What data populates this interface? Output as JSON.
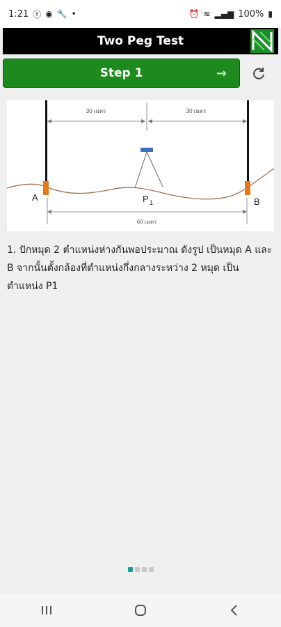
{
  "status": {
    "time": "1:21",
    "battery": "100%"
  },
  "appbar": {
    "title": "Two Peg Test"
  },
  "step": {
    "label": "Step 1"
  },
  "diagram": {
    "label_a": "A",
    "label_b": "B",
    "label_p": "P",
    "label_p_sub": "1",
    "dim_left": "30 เมตร",
    "dim_right": "30 เมตร",
    "dim_total": "60 เมตร"
  },
  "instruction": {
    "text": "1. ปักหมุด 2 ตำแหน่งห่างกันพอประมาณ ดังรูป เป็นหมุด  A และ B จากนั้นตั้งกล้องที่ตำแหน่งกึ่งกลางระหว่าง 2 หมุด เป็นตำแหน่ง P1"
  },
  "pager": {
    "count": 4,
    "active_index": 0
  },
  "colors": {
    "step_button": "#1c8a1c",
    "appbar": "#000000",
    "peg": "#e77817",
    "ground": "#a07050",
    "instrument": "#3a6fc4"
  }
}
